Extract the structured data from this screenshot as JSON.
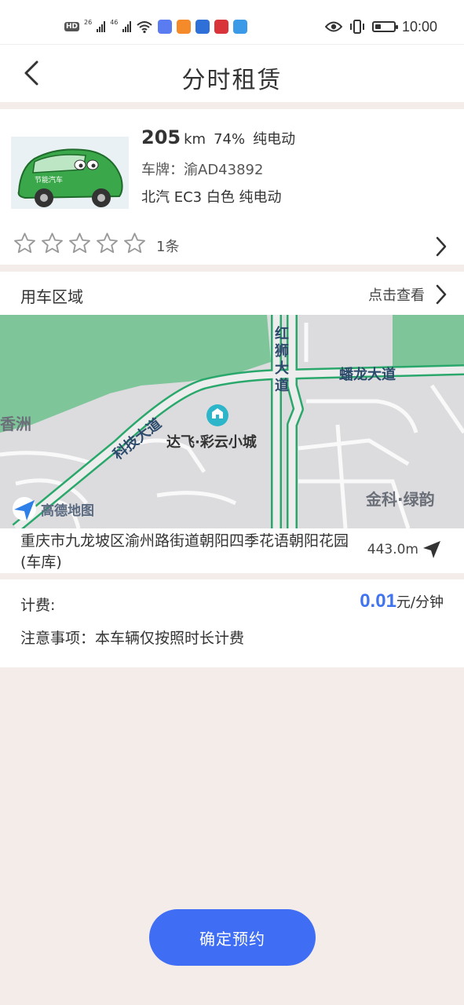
{
  "status_bar": {
    "hd_label": "HD",
    "net1": "26",
    "net2": "46",
    "time": "10:00",
    "battery_level": 0.3
  },
  "header": {
    "title": "分时租赁",
    "back_icon": "chevron-left-icon"
  },
  "vehicle": {
    "image_caption": "节能汽车",
    "range_value": "205",
    "range_unit": "km",
    "battery_percent": "74%",
    "energy_type": "纯电动",
    "plate": "车牌：渝AD43892",
    "model": "北汽 EC3 白色 纯电动",
    "rating": 0,
    "rating_max": 5,
    "review_count": "1条"
  },
  "area": {
    "title": "用车区域",
    "view_label": "点击查看",
    "map": {
      "road_labels": [
        "红狮大道",
        "蟠龙大道",
        "科技大道"
      ],
      "poi": "达飞·彩云小城",
      "left_label": "香洲",
      "right_label": "金科·绿韵",
      "logo_text": "高德地图"
    },
    "address": "重庆市九龙坡区渝州路街道朝阳四季花语朝阳花园(车库)",
    "distance": "443.0m"
  },
  "fee": {
    "label": "计费:",
    "price": "0.01",
    "unit": "元/分钟",
    "notice": "注意事项：本车辆仅按照时长计费"
  },
  "action": {
    "reserve_label": "确定预约",
    "color": "#3f6ef5"
  },
  "colors": {
    "accent": "#3f73f0",
    "map_road": "#2aa86b",
    "map_green": "#7fc59a"
  }
}
